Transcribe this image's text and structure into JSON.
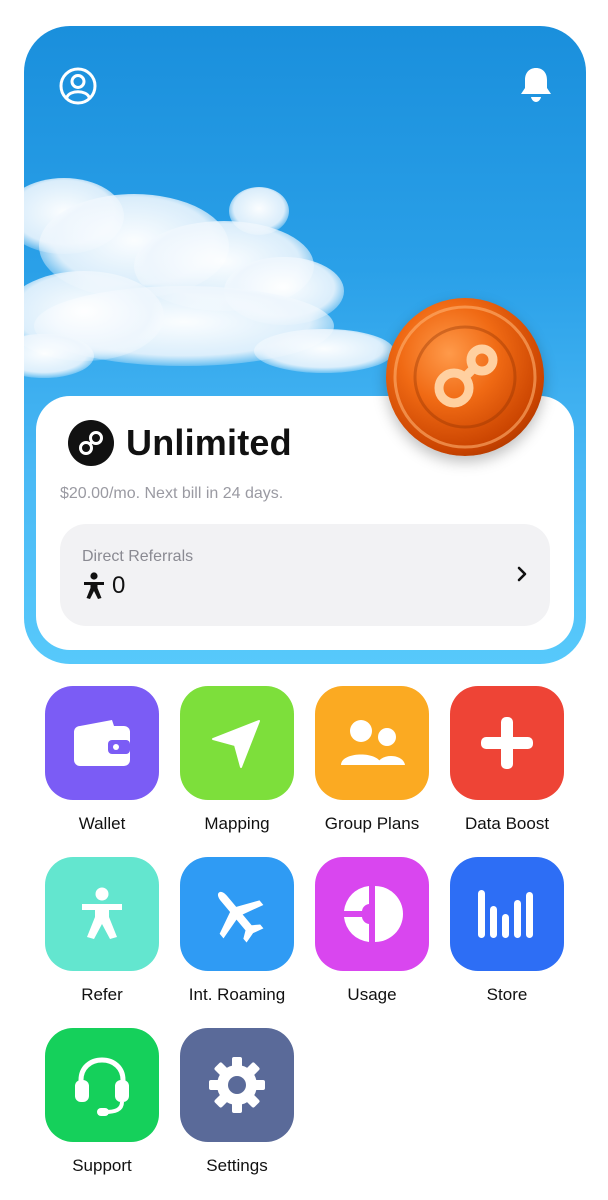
{
  "header": {
    "profile_icon": "profile-icon",
    "bell_icon": "bell-icon"
  },
  "plan": {
    "name": "Unlimited",
    "price_text": "$20.00/mo. Next bill in 24 days.",
    "logo_icon": "helium-logo-icon"
  },
  "referrals": {
    "label": "Direct Referrals",
    "count": "0",
    "icon": "person-icon"
  },
  "colors": {
    "hero_top": "#1a8fdc",
    "hero_bottom": "#57c9fb",
    "wallet": "#7b5cf5",
    "mapping": "#7ddf3b",
    "group_plans": "#fbaa22",
    "data_boost": "#ee4436",
    "refer": "#63e6cf",
    "int_roaming": "#2f9bf4",
    "usage": "#d946ef",
    "store": "#2d6ef5",
    "support": "#15d05b",
    "settings": "#5a6a99"
  },
  "tiles": [
    {
      "label": "Wallet",
      "icon": "wallet-icon"
    },
    {
      "label": "Mapping",
      "icon": "navigation-arrow-icon"
    },
    {
      "label": "Group Plans",
      "icon": "group-icon"
    },
    {
      "label": "Data Boost",
      "icon": "plus-icon"
    },
    {
      "label": "Refer",
      "icon": "person-icon"
    },
    {
      "label": "Int. Roaming",
      "icon": "airplane-icon"
    },
    {
      "label": "Usage",
      "icon": "pie-chart-icon"
    },
    {
      "label": "Store",
      "icon": "bar-chart-icon"
    },
    {
      "label": "Support",
      "icon": "headset-icon"
    },
    {
      "label": "Settings",
      "icon": "gear-icon"
    }
  ]
}
